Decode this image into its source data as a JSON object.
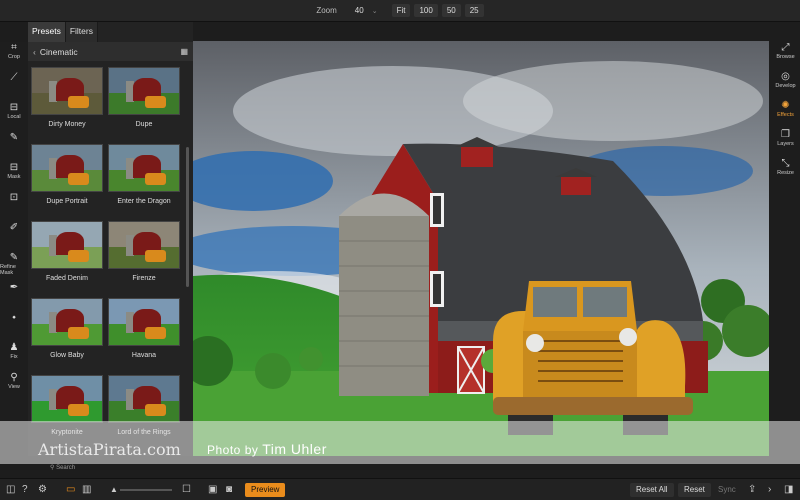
{
  "topbar": {
    "zoom_label": "Zoom",
    "zoom_value": "40",
    "zoom_chevron": "⌄",
    "presets": [
      "Fit",
      "100",
      "50",
      "25"
    ]
  },
  "left_tools": [
    {
      "icon": "crop-icon",
      "glyph": "⌗",
      "label": "Crop"
    },
    {
      "icon": "brush-icon",
      "glyph": "⟋",
      "label": ""
    },
    {
      "icon": "gradient-icon",
      "glyph": "⊟",
      "label": "Local"
    },
    {
      "icon": "mask-brush-icon",
      "glyph": "✎",
      "label": ""
    },
    {
      "icon": "mask-icon",
      "glyph": "⊟",
      "label": "Mask"
    },
    {
      "icon": "selection-icon",
      "glyph": "⊡",
      "label": ""
    },
    {
      "icon": "pen-icon",
      "glyph": "✐",
      "label": ""
    },
    {
      "icon": "refine-icon",
      "glyph": "✎",
      "label": "Refine Mask"
    },
    {
      "icon": "retouch-icon",
      "glyph": "✒",
      "label": ""
    },
    {
      "icon": "clone-icon",
      "glyph": "⬩",
      "label": ""
    },
    {
      "icon": "person-icon",
      "glyph": "♟",
      "label": "Fix"
    },
    {
      "icon": "magnifier-icon",
      "glyph": "⚲",
      "label": "View"
    }
  ],
  "panel": {
    "tabs": [
      "Presets",
      "Filters"
    ],
    "category": "Cinematic",
    "thumbnails": [
      {
        "label": "Dirty Money",
        "sky": "#6c6453",
        "grass": "#5d5a3a"
      },
      {
        "label": "Dupe",
        "sky": "#5a7286",
        "grass": "#3c7a2a"
      },
      {
        "label": "Dupe Portrait",
        "sky": "#6d8394",
        "grass": "#5a8a3a"
      },
      {
        "label": "Enter the Dragon",
        "sky": "#6f8a9c",
        "grass": "#49862d"
      },
      {
        "label": "Faded Denim",
        "sky": "#95a7b3",
        "grass": "#7ba056"
      },
      {
        "label": "Firenze",
        "sky": "#8d8677",
        "grass": "#556d30"
      },
      {
        "label": "Glow Baby",
        "sky": "#839aac",
        "grass": "#4f9a34"
      },
      {
        "label": "Havana",
        "sky": "#7b98b3",
        "grass": "#3f8f2b"
      },
      {
        "label": "Kryptonite",
        "sky": "#6f8fa6",
        "grass": "#2f9a2f"
      },
      {
        "label": "Lord of the Rings",
        "sky": "#5e7990",
        "grass": "#3a7f2a"
      }
    ],
    "search_placeholder": "Search"
  },
  "photo": {
    "credit_prefix": "Photo by ",
    "credit_name": "Tim Uhler"
  },
  "watermark": "ArtistaPirata.com",
  "right_tools": [
    {
      "icon": "browse-icon",
      "glyph": "⤢",
      "label": "Browse",
      "active": false
    },
    {
      "icon": "develop-icon",
      "glyph": "◎",
      "label": "Develop",
      "active": false
    },
    {
      "icon": "effects-icon",
      "glyph": "✺",
      "label": "Effects",
      "active": true
    },
    {
      "icon": "layers-icon",
      "glyph": "❐",
      "label": "Layers",
      "active": false
    },
    {
      "icon": "resize-icon",
      "glyph": "⤡",
      "label": "Resize",
      "active": false
    }
  ],
  "bottombar": {
    "preview": "Preview",
    "reset_all": "Reset All",
    "reset": "Reset",
    "sync": "Sync"
  },
  "colors": {
    "accent": "#e98c1c",
    "barn_red": "#9b1e1c",
    "truck_yellow": "#e0a126"
  }
}
